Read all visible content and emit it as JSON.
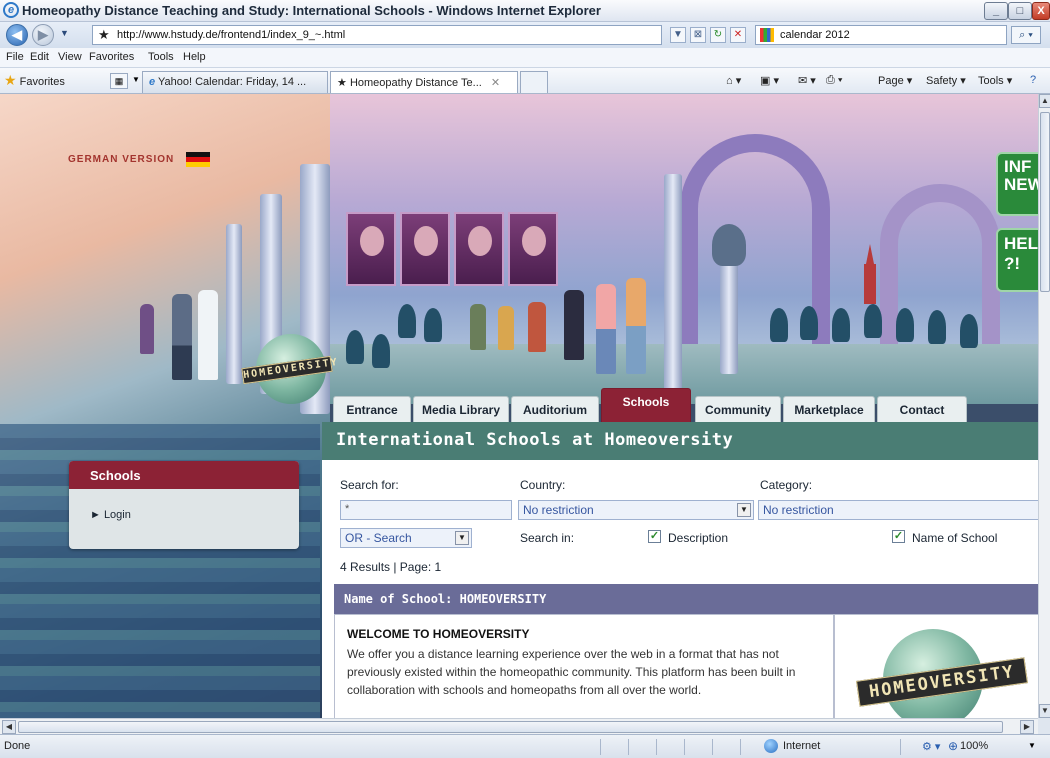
{
  "window": {
    "title": "Homeopathy Distance Teaching and Study: International Schools - Windows Internet Explorer",
    "min": "_",
    "max": "□",
    "close": "X"
  },
  "address": {
    "url": "http://www.hstudy.de/frontend1/index_9_~.html",
    "search_value": "calendar 2012"
  },
  "menu": {
    "items": [
      "File",
      "Edit",
      "View",
      "Favorites",
      "Tools",
      "Help"
    ]
  },
  "favbar": {
    "favorites_label": "Favorites",
    "tabs": [
      {
        "label": "Yahoo! Calendar: Friday, 14 ..."
      },
      {
        "label": "Homeopathy Distance Te..."
      }
    ],
    "commands": [
      "Page ▾",
      "Safety ▾",
      "Tools ▾"
    ]
  },
  "page": {
    "german_version": "GERMAN VERSION",
    "badge_info": [
      "INF",
      "NEW"
    ],
    "badge_help": [
      "HEL",
      "?!"
    ],
    "globe_band_small": "HOMEOVERSITY",
    "globe_band_large": "HOMEOVERSITY",
    "nav_tabs": [
      "Entrance",
      "Media Library",
      "Auditorium",
      "Schools",
      "Community",
      "Marketplace",
      "Contact"
    ],
    "section_title": "International Schools at Homeoversity",
    "sidebar": {
      "title": "Schools",
      "items": [
        "► Login"
      ]
    },
    "search": {
      "search_for_label": "Search for:",
      "search_value": "*",
      "country_label": "Country:",
      "country_value": "No restriction",
      "category_label": "Category:",
      "category_value": "No restriction",
      "mode_value": "OR - Search",
      "search_in_label": "Search in:",
      "opt_description": "Description",
      "opt_name": "Name of School"
    },
    "results_info": "4 Results | Page:  1",
    "result": {
      "header": "Name of School: HOMEOVERSITY",
      "title": "WELCOME TO HOMEOVERSITY",
      "text": "We offer you a distance learning experience over the web in a format that has not previously existed within the homeopathic community. This platform has been built in collaboration with schools and homeopaths from all over the world."
    }
  },
  "status": {
    "text": "Done",
    "zone": "Internet",
    "zoom": "100%"
  },
  "colors": {
    "schools_tab": "#8c2235",
    "section_header": "#4a7d74",
    "result_header": "#6a6c98"
  }
}
